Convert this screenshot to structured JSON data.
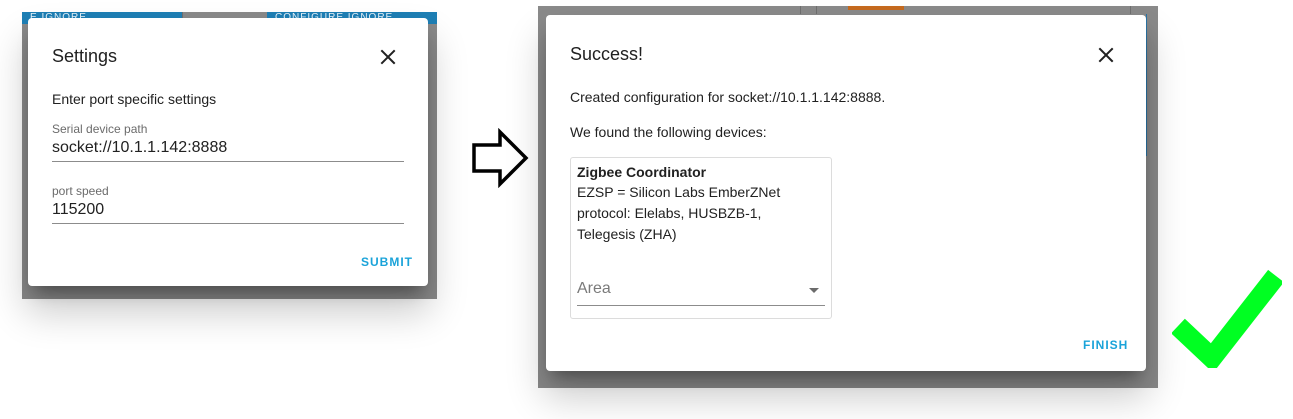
{
  "left_panel": {
    "background_strip_text_1": "E   IGNORE",
    "background_strip_text_2": "CONFIGURE   IGNORE",
    "dialog": {
      "title": "Settings",
      "close_icon": "close-icon",
      "intro": "Enter port specific settings",
      "fields": [
        {
          "label": "Serial device path",
          "value": "socket://10.1.1.142:8888"
        },
        {
          "label": "port speed",
          "value": "115200"
        }
      ],
      "submit_label": "SUBMIT"
    }
  },
  "transition_icon": "arrow-right-outline-icon",
  "right_panel": {
    "dialog": {
      "title": "Success!",
      "close_icon": "close-icon",
      "created_text": "Created configuration for socket://10.1.1.142:8888.",
      "found_text": "We found the following devices:",
      "device": {
        "name": "Zigbee Coordinator",
        "description": "EZSP = Silicon Labs EmberZNet\nprotocol: Elelabs, HUSBZB-1,\nTelegesis (ZHA)",
        "area_placeholder": "Area"
      },
      "finish_label": "FINISH"
    }
  },
  "success_icon": "checkmark-icon",
  "colors": {
    "accent": "#1aa3d9",
    "check_green": "#00ff22",
    "backdrop": "#8a8a8a"
  }
}
